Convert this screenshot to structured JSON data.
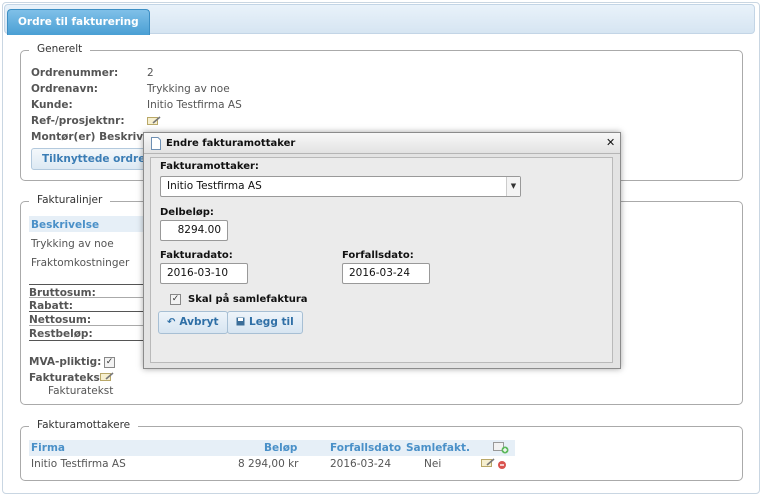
{
  "tab": {
    "label": "Ordre til fakturering"
  },
  "generelt": {
    "legend": "Generelt",
    "fields": [
      {
        "label": "Ordrenummer:",
        "value": "2"
      },
      {
        "label": "Ordrenavn:",
        "value": "Trykking av noe"
      },
      {
        "label": "Kunde:",
        "value": "Initio Testfirma AS"
      },
      {
        "label": "Ref-/prosjektnr:",
        "value": ""
      },
      {
        "label": "Montør(er) Beskrivelse",
        "value": ""
      }
    ],
    "button": "Tilknyttede ordrer"
  },
  "fakturalinjer": {
    "legend": "Fakturalinjer",
    "header": "Beskrivelse",
    "rows": [
      "Trykking av noe",
      "Fraktomkostninger"
    ],
    "sums": [
      "Bruttosum:",
      "Rabatt:",
      "Nettosum:",
      "Restbeløp:"
    ],
    "mva_label": "MVA-pliktig:",
    "mva_checked": true,
    "fakturatekst_label": "Fakturatekst:",
    "fakturatekst_value": "Fakturatekst"
  },
  "fakturamottakere": {
    "legend": "Fakturamottakere",
    "columns": [
      "Firma",
      "Beløp",
      "Forfallsdato",
      "Samlefakt."
    ],
    "rows": [
      {
        "firma": "Initio Testfirma AS",
        "belop": "8 294,00 kr",
        "forfall": "2016-03-24",
        "samle": "Nei"
      }
    ]
  },
  "modal": {
    "title": "Endre fakturamottaker",
    "close": "✕",
    "mottaker_label": "Fakturamottaker:",
    "mottaker_value": "Initio Testfirma AS",
    "delbelop_label": "Delbeløp:",
    "delbelop_value": "8294.00",
    "fakturadato_label": "Fakturadato:",
    "fakturadato_value": "2016-03-10",
    "forfallsdato_label": "Forfallsdato:",
    "forfallsdato_value": "2016-03-24",
    "samle_label": "Skal på samlefaktura",
    "samle_checked": true,
    "cancel": "Avbryt",
    "submit": "Legg til"
  },
  "icons": {
    "edit": "pencil-note-icon",
    "add": "add-recipient-icon",
    "delete": "edit-delete-icon",
    "doc": "document-icon",
    "undo": "undo-arrow-icon",
    "save": "save-disk-icon"
  },
  "colors": {
    "accent": "#4a9fd4",
    "header_text": "#4a90c8"
  }
}
